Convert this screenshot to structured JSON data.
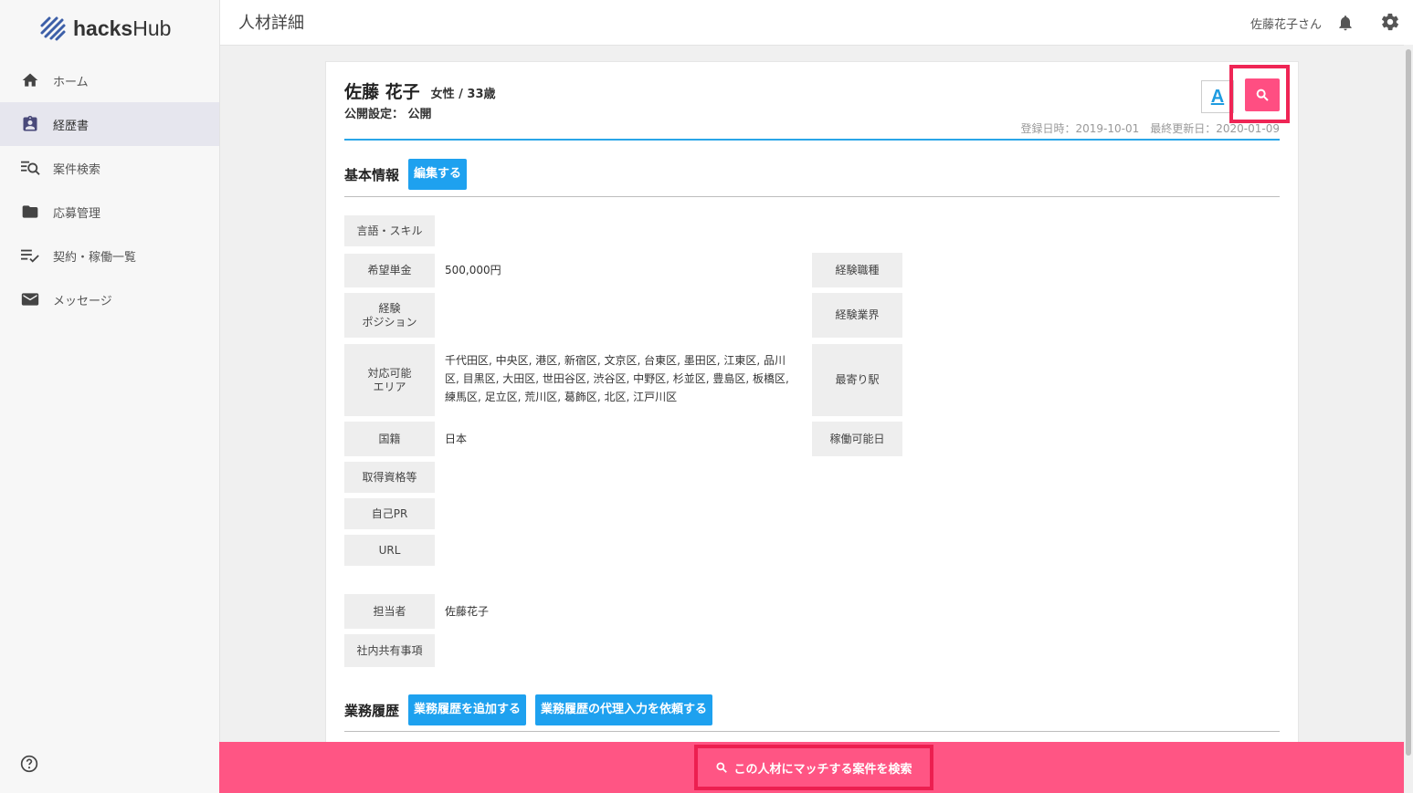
{
  "app": {
    "logo_text_bold": "hacks",
    "logo_text_rest": "Hub"
  },
  "sidebar": {
    "items": [
      {
        "label": "ホーム",
        "icon": "home-icon"
      },
      {
        "label": "経歴書",
        "icon": "resume-icon",
        "active": true
      },
      {
        "label": "案件検索",
        "icon": "search-list-icon"
      },
      {
        "label": "応募管理",
        "icon": "folder-icon"
      },
      {
        "label": "契約・稼働一覧",
        "icon": "checklist-icon"
      },
      {
        "label": "メッセージ",
        "icon": "mail-icon"
      }
    ],
    "help_icon": "help-icon"
  },
  "header": {
    "title": "人材詳細",
    "user": "佐藤花子さん"
  },
  "profile": {
    "name": "佐藤 花子",
    "gender_age": "女性 / 33歳",
    "visibility": "公開設定： 公開",
    "dates": "登録日時：2019-10-01　最終更新日：2020-01-09"
  },
  "basic_info": {
    "title": "基本情報",
    "edit_button": "編集する",
    "labels": {
      "skills": "言語・スキル",
      "rate": "希望単金",
      "position": "経験\nポジション",
      "area": "対応可能\nエリア",
      "nationality": "国籍",
      "qualifications": "取得資格等",
      "pr": "自己PR",
      "url": "URL",
      "job_type": "経験職種",
      "industry": "経験業界",
      "station": "最寄り駅",
      "start_date": "稼働可能日",
      "manager": "担当者",
      "internal_notes": "社内共有事項"
    },
    "values": {
      "rate": "500,000円",
      "area": "千代田区, 中央区, 港区, 新宿区, 文京区, 台東区, 墨田区, 江東区, 品川区, 目黒区, 大田区, 世田谷区, 渋谷区, 中野区, 杉並区, 豊島区, 板橋区, 練馬区, 足立区, 荒川区, 葛飾区, 北区, 江戸川区",
      "nationality": "日本",
      "manager": "佐藤花子"
    }
  },
  "work_history": {
    "title": "業務履歴",
    "add_button": "業務履歴を追加する",
    "request_button": "業務履歴の代理入力を依頼する"
  },
  "bottom_bar": {
    "search_label": "この人材にマッチする案件を検索"
  },
  "colors": {
    "accent_pink": "#ff5584",
    "highlight_red": "#ec1f50",
    "button_blue": "#1ea1ef",
    "header_line_blue": "#2aa6e8"
  }
}
